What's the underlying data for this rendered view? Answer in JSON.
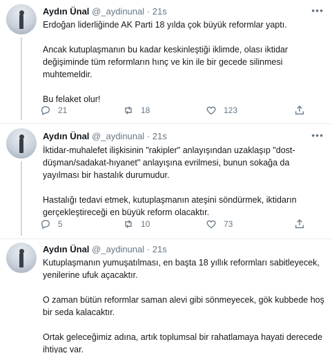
{
  "tweets": [
    {
      "author_name": "Aydın Ünal",
      "handle": "@_aydinunal",
      "separator": "·",
      "time": "21s",
      "paragraphs": [
        "Erdoğan liderliğinde AK Parti 18 yılda çok büyük reformlar yaptı.",
        "Ancak kutuplaşmanın bu kadar keskinleştiği iklimde, olası iktidar değişiminde tüm reformların hınç ve kin ile bir gecede silinmesi muhtemeldir.",
        "Bu felaket olur!"
      ],
      "replies": "21",
      "retweets": "18",
      "likes": "123"
    },
    {
      "author_name": "Aydın Ünal",
      "handle": "@_aydinunal",
      "separator": "·",
      "time": "21s",
      "paragraphs": [
        "İktidar-muhalefet ilişkisinin \"rakipler\" anlayışından uzaklaşıp \"dost-düşman/sadakat-hıyanet\" anlayışına evrilmesi, bunun sokağa da yayılması bir hastalık durumudur.",
        "Hastalığı tedavi etmek, kutuplaşmanın ateşini söndürmek,  iktidarın gerçekleştireceği en büyük reform olacaktır."
      ],
      "replies": "5",
      "retweets": "10",
      "likes": "73"
    },
    {
      "author_name": "Aydın Ünal",
      "handle": "@_aydinunal",
      "separator": "·",
      "time": "21s",
      "paragraphs": [
        "Kutuplaşmanın yumuşatılması, en başta 18 yıllık reformları sabitleyecek, yenilerine ufuk açacaktır.",
        "O zaman bütün reformlar saman alevi gibi sönmeyecek, gök kubbede hoş bir seda kalacaktır.",
        "Ortak geleceğimiz adına, artık toplumsal bir rahatlamaya hayati derecede ihtiyaç var."
      ]
    }
  ],
  "icons": {
    "more": "more-dots-icon",
    "reply": "reply-icon",
    "retweet": "retweet-icon",
    "like": "heart-icon",
    "share": "share-icon"
  },
  "colors": {
    "text": "#14171a",
    "muted": "#657786",
    "divider": "#e6ecf0",
    "thread": "#cfd9de"
  }
}
